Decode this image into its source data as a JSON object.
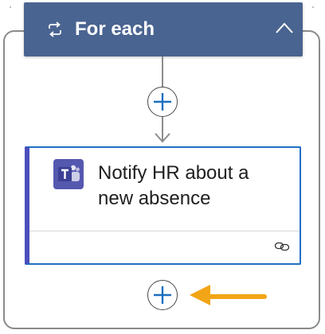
{
  "foreach": {
    "title": "For each",
    "loop_icon": "loop-icon",
    "collapse_icon": "chevron-up-icon"
  },
  "action": {
    "title": "Notify HR about a new absence",
    "app_icon": "teams-icon",
    "footer_icon": "link-icon",
    "accent_color": "#4b4fbd",
    "border_color": "#1f6fc4"
  },
  "add_buttons": [
    {
      "icon": "plus-icon",
      "position": "between-steps"
    },
    {
      "icon": "plus-icon",
      "position": "after-action"
    }
  ],
  "annotation": {
    "icon": "callout-arrow-icon",
    "color": "#f2a516"
  },
  "colors": {
    "header_bg": "#4a6491",
    "teams_bg": "#5558af"
  }
}
